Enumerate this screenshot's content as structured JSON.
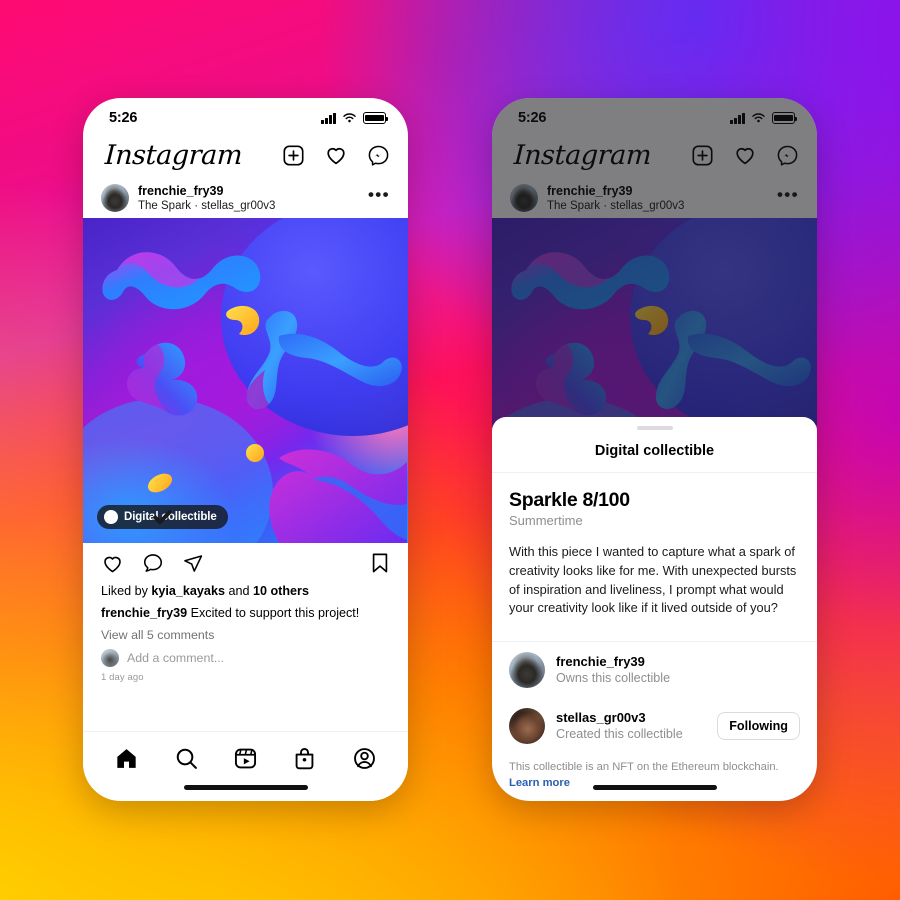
{
  "background": {
    "description": "Instagram brand gradient",
    "colors": [
      "#ff0a72",
      "#e01bb5",
      "#8a10ef",
      "#3a4bf5",
      "#ff4d00",
      "#ffd600"
    ]
  },
  "phone_left": {
    "status_bar": {
      "time": "5:26",
      "icons": [
        "signal-icon",
        "wifi-icon",
        "battery-icon"
      ]
    },
    "app_bar": {
      "wordmark": "Instagram",
      "actions": [
        "add-post-icon",
        "activity-heart-icon",
        "messenger-icon"
      ]
    },
    "post_header": {
      "username": "frenchie_fry39",
      "subtitle": "The Spark · stellas_gr00v3",
      "more_label": "•••"
    },
    "media": {
      "badge_label": "Digital collectible",
      "badge_icon": "verified-check-icon"
    },
    "actions": {
      "like": "like-heart-icon",
      "comment": "comment-bubble-icon",
      "share": "share-paperplane-icon",
      "save": "bookmark-icon"
    },
    "caption": {
      "likes_prefix": "Liked by ",
      "likes_user": "kyia_kayaks",
      "likes_mid": " and ",
      "likes_count": "10 others",
      "author": "frenchie_fry39",
      "text": " Excited to support this project!",
      "view_comments": "View all 5 comments",
      "add_comment_placeholder": "Add a comment...",
      "timestamp": "1 day ago"
    },
    "tab_bar": {
      "items": [
        {
          "name": "home-icon",
          "label": "Home"
        },
        {
          "name": "search-icon",
          "label": "Search"
        },
        {
          "name": "reels-icon",
          "label": "Reels"
        },
        {
          "name": "shop-icon",
          "label": "Shop"
        },
        {
          "name": "profile-icon",
          "label": "Profile"
        }
      ]
    }
  },
  "phone_right": {
    "status_bar": {
      "time": "5:26"
    },
    "app_bar": {
      "wordmark": "Instagram"
    },
    "post_header": {
      "username": "frenchie_fry39",
      "subtitle": "The Spark · stellas_gr00v3",
      "more_label": "•••"
    },
    "sheet": {
      "title": "Digital collectible",
      "nft_title": "Sparkle 8/100",
      "nft_subtitle": "Summertime",
      "description": "With this piece I wanted to capture what a spark of creativity looks like for me. With unexpected bursts of inspiration and liveliness, I prompt what would your creativity look like if it lived outside of you?",
      "people": [
        {
          "username": "frenchie_fry39",
          "role": "Owns this collectible",
          "button": null
        },
        {
          "username": "stellas_gr00v3",
          "role": "Created this collectible",
          "button": "Following"
        }
      ],
      "legal_text": "This collectible is an NFT on the Ethereum blockchain. ",
      "legal_link": "Learn more"
    }
  }
}
